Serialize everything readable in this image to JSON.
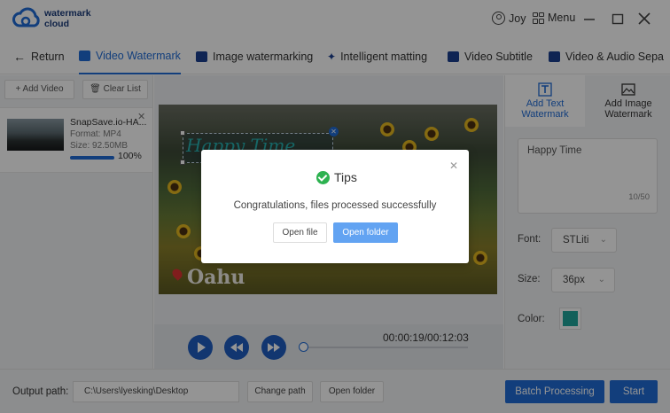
{
  "app": {
    "logo_line1": "watermark",
    "logo_line2": "cloud"
  },
  "header": {
    "user_name": "Joy",
    "menu_label": "Menu"
  },
  "nav": {
    "return_label": "Return",
    "tabs": [
      "Video Watermark",
      "Image watermarking",
      "Intelligent matting",
      "Video Subtitle",
      "Video & Audio Sepa"
    ]
  },
  "left_panel": {
    "add_video_label": "+ Add Video",
    "clear_list_label": "Clear List",
    "file": {
      "name": "SnapSave.io-HA...",
      "format": "Format:  MP4",
      "size": "Size:  92.50MB",
      "progress_text": "100%",
      "progress_fraction": 1.0
    }
  },
  "preview": {
    "watermark_text": "Happy Time",
    "video_caption": "Oahu",
    "timecode": "00:00:19/00:12:03"
  },
  "right_panel": {
    "tab_text": "Add Text Watermark",
    "tab_image": "Add Image Watermark",
    "text_value": "Happy Time",
    "char_count": "10/50",
    "font_label": "Font:",
    "font_value": "STLiti",
    "size_label": "Size:",
    "size_value": "36px",
    "color_label": "Color:",
    "color_value": "#1fa59b"
  },
  "bottom": {
    "output_label": "Output path:",
    "output_path": "C:\\Users\\lyesking\\Desktop",
    "change_path_label": "Change path",
    "open_folder_label": "Open folder",
    "batch_label": "Batch Processing",
    "start_label": "Start"
  },
  "dialog": {
    "title": "Tips",
    "message": "Congratulations, files processed successfully",
    "open_file_label": "Open file",
    "open_folder_label": "Open folder"
  },
  "colors": {
    "accent": "#1f6bd6",
    "success": "#2db250",
    "dialog_primary": "#62a3f2"
  }
}
